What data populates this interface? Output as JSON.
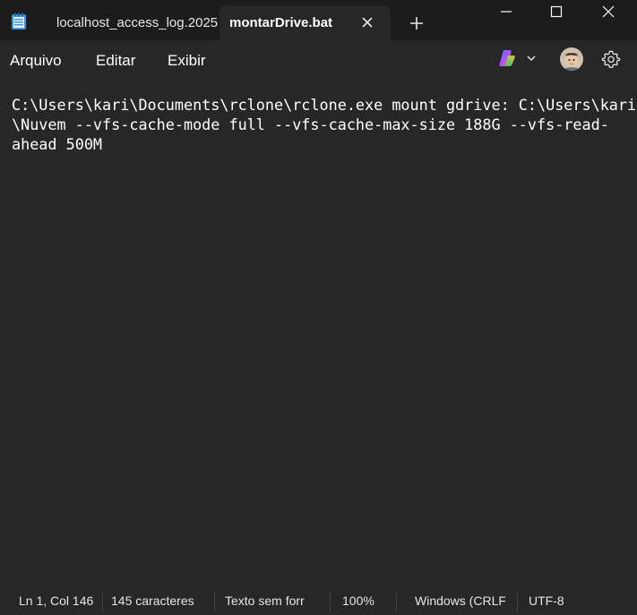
{
  "tabs": [
    {
      "title": "localhost_access_log.2025",
      "active": false
    },
    {
      "title": "montarDrive.bat",
      "active": true
    }
  ],
  "icons": {
    "app": "notepad-icon",
    "tab_close": "close-icon",
    "new_tab": "plus-icon",
    "window_minimize": "minimize-icon",
    "window_maximize": "maximize-icon",
    "window_close": "close-icon",
    "copilot": "copilot-icon",
    "dropdown": "chevron-down-icon",
    "avatar": "user-avatar",
    "settings": "gear-icon"
  },
  "menu": {
    "file": "Arquivo",
    "edit": "Editar",
    "view": "Exibir"
  },
  "editor": {
    "content_lines": [
      "C:\\Users\\kari\\Documents\\rclone\\rclone.exe mount gdrive: C:\\Users\\kari",
      "\\Nuvem --vfs-cache-mode full --vfs-cache-max-size 188G --vfs-read-",
      "ahead 500M"
    ]
  },
  "status": {
    "position": "Ln 1, Col 146",
    "char_count": "145 caracteres",
    "format": "Texto sem forr",
    "zoom": "100%",
    "line_ending": "Windows (CRLF",
    "encoding": "UTF-8"
  },
  "colors": {
    "titlebar": "#1c1c1c",
    "background": "#272727",
    "text": "#ffffff"
  }
}
